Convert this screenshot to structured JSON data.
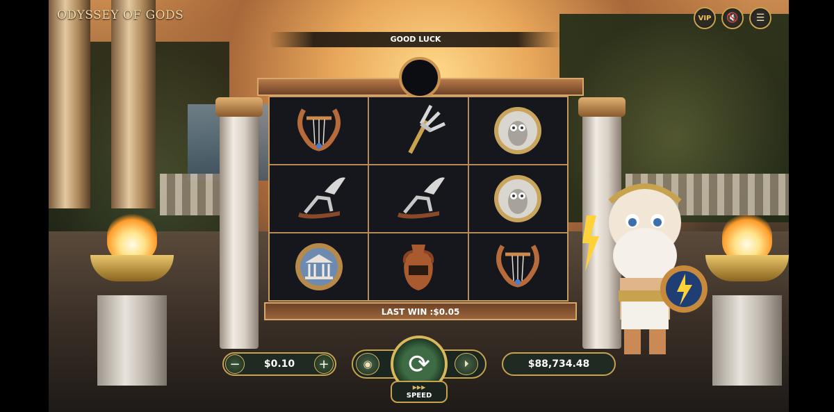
{
  "header": {
    "logo_text": "ODYSSEY OF GODS",
    "buttons": [
      {
        "icon": "vip-icon",
        "label": "VIP"
      },
      {
        "icon": "sound-muted-icon",
        "label": "🔇"
      },
      {
        "icon": "menu-icon",
        "label": "☰"
      }
    ]
  },
  "banner": {
    "message": "GOOD LUCK"
  },
  "reels": {
    "grid": [
      [
        "lyre",
        "trident",
        "owl-coin"
      ],
      [
        "winged-sandal",
        "winged-sandal",
        "owl-coin"
      ],
      [
        "temple-coin",
        "amphora",
        "lyre"
      ]
    ]
  },
  "last_win": {
    "text": "LAST WIN :$0.05"
  },
  "controls": {
    "bet_value": "$0.10",
    "minus_label": "−",
    "plus_label": "+",
    "speed_label": "SPEED",
    "speed_arrows": "▶▶▶",
    "spin_glyph": "⟳",
    "coins_glyph": "◉",
    "auto_glyph": "⏵",
    "balance": "$88,734.48"
  }
}
